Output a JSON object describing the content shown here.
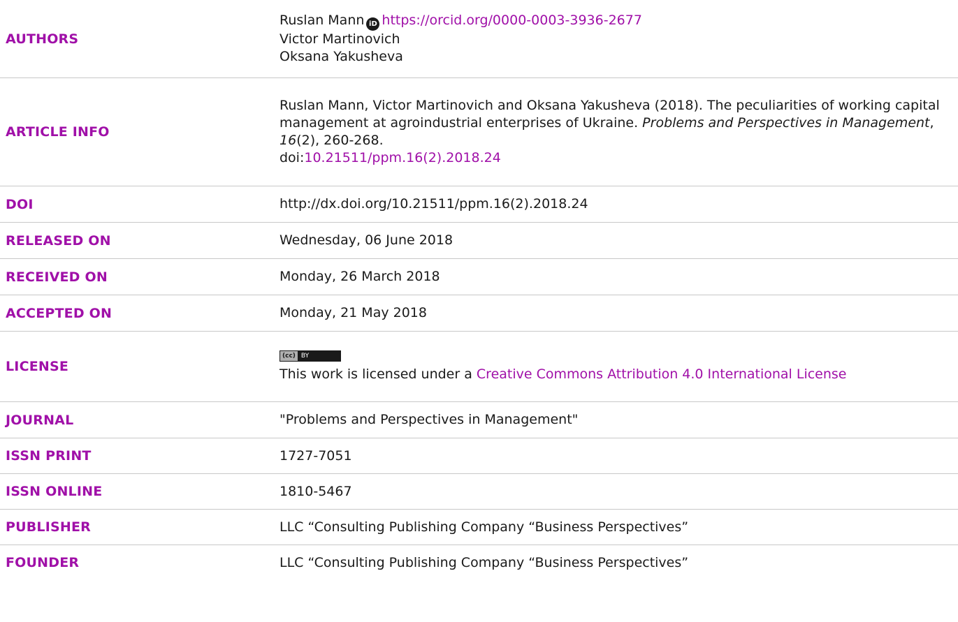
{
  "rows": {
    "authors": {
      "label": "AUTHORS",
      "author1": "Ruslan Mann",
      "orcid_icon": "orcid-icon",
      "orcid_url": "https://orcid.org/0000-0003-3936-2677",
      "author2": "Victor Martinovich",
      "author3": "Oksana Yakusheva"
    },
    "article_info": {
      "label": "ARTICLE INFO",
      "citation_prefix": "Ruslan Mann, Victor Martinovich and Oksana Yakusheva (2018). The peculiarities of working capital management at agroindustrial enterprises of Ukraine. ",
      "journal": "Problems and Perspectives in Management",
      "sep1": ", ",
      "volume": "16",
      "issue_pages": "(2), 260-268.",
      "doi_prefix": "doi:",
      "doi": "10.21511/ppm.16(2).2018.24"
    },
    "doi": {
      "label": "DOI",
      "value": "http://dx.doi.org/10.21511/ppm.16(2).2018.24"
    },
    "released_on": {
      "label": "RELEASED ON",
      "value": "Wednesday, 06 June 2018"
    },
    "received_on": {
      "label": "RECEIVED ON",
      "value": "Monday, 26 March 2018"
    },
    "accepted_on": {
      "label": "ACCEPTED ON",
      "value": "Monday, 21 May 2018"
    },
    "license": {
      "label": "LICENSE",
      "badge_left": "(cc)",
      "badge_right": "BY",
      "text_prefix": "This work is licensed under a ",
      "link": "Creative Commons Attribution 4.0 International License"
    },
    "journal": {
      "label": "JOURNAL",
      "value": "\"Problems and Perspectives in Management\""
    },
    "issn_print": {
      "label": "ISSN PRINT",
      "value": "1727-7051"
    },
    "issn_online": {
      "label": "ISSN ONLINE",
      "value": "1810-5467"
    },
    "publisher": {
      "label": "PUBLISHER",
      "value": "LLC “Consulting Publishing Company “Business Perspectives”"
    },
    "founder": {
      "label": "FOUNDER",
      "value": "LLC “Consulting Publishing Company “Business Perspectives”"
    }
  },
  "colors": {
    "label": "#a010a8",
    "link": "#a010a8",
    "text": "#1a1a1a",
    "divider": "#c8c8c8"
  }
}
